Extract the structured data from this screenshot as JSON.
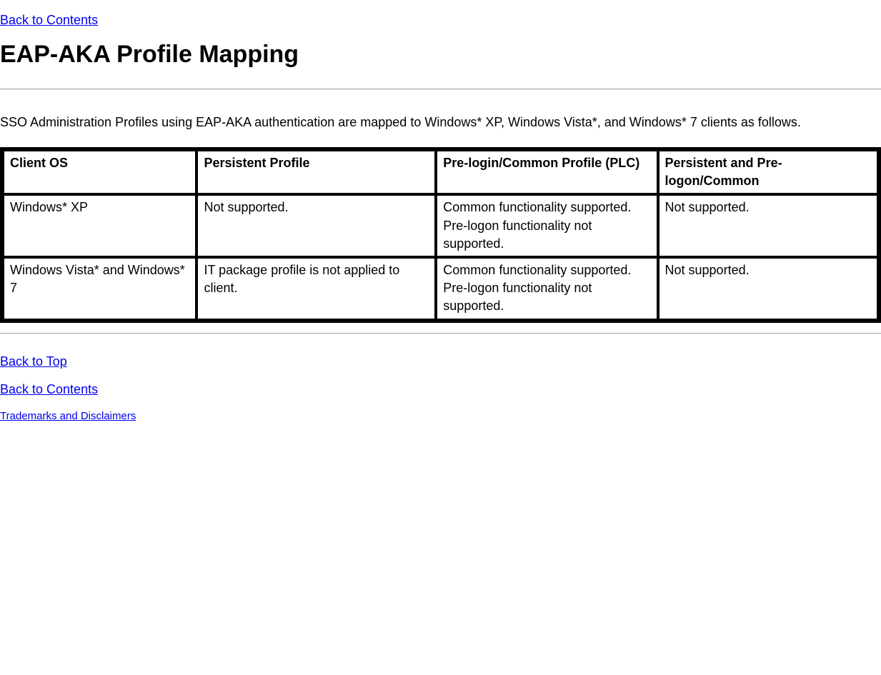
{
  "links": {
    "back_to_contents_top": "Back to Contents",
    "back_to_top": "Back to Top",
    "back_to_contents_bottom": "Back to Contents",
    "trademarks": "Trademarks and Disclaimers"
  },
  "heading": "EAP-AKA Profile Mapping",
  "intro": "SSO Administration Profiles using EAP-AKA authentication are mapped to Windows* XP, Windows Vista*, and Windows* 7 clients as follows.",
  "table": {
    "headers": {
      "client_os": "Client OS",
      "persistent_profile": "Persistent Profile",
      "prelogin_common": "Pre-login/Common Profile (PLC)",
      "persistent_prelogon": "Persistent and Pre-logon/Common"
    },
    "rows": [
      {
        "client_os": "Windows* XP",
        "persistent_profile": "Not supported.",
        "prelogin_common": "Common functionality supported.\nPre-logon functionality not supported.",
        "persistent_prelogon": "Not supported."
      },
      {
        "client_os": "Windows Vista* and Windows* 7",
        "persistent_profile": "IT package profile is not applied to client.",
        "prelogin_common": "Common functionality supported.\nPre-logon functionality not supported.",
        "persistent_prelogon": "Not supported."
      }
    ]
  }
}
